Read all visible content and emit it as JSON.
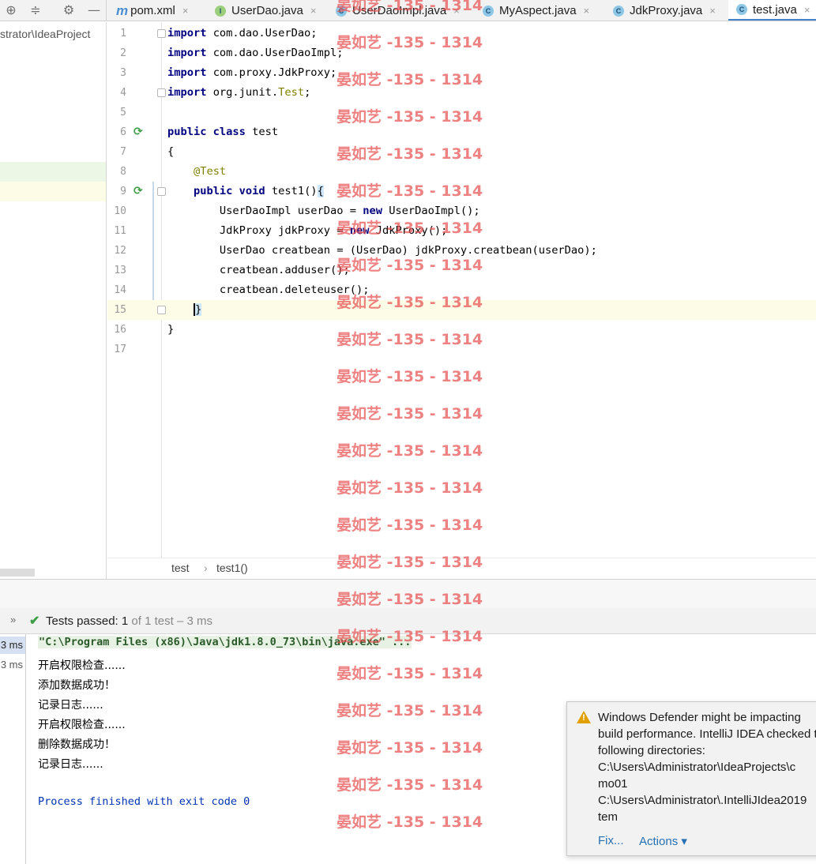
{
  "tabs": [
    {
      "label": "pom.xml",
      "icon": "maven-icon",
      "close": "×"
    },
    {
      "label": "UserDao.java",
      "icon": "interface-icon",
      "close": "×"
    },
    {
      "label": "UserDaoImpl.java",
      "icon": "class-icon",
      "close": "×"
    },
    {
      "label": "MyAspect.java",
      "icon": "class-icon",
      "close": "×"
    },
    {
      "label": "JdkProxy.java",
      "icon": "class-icon",
      "close": "×"
    },
    {
      "label": "test.java",
      "icon": "test-class-icon",
      "close": "×"
    }
  ],
  "project": {
    "path": "strator\\IdeaProject"
  },
  "editor": {
    "lines": [
      {
        "n": "1",
        "code": "import com.dao.UserDao;"
      },
      {
        "n": "2",
        "code": "import com.dao.UserDaoImpl;"
      },
      {
        "n": "3",
        "code": "import com.proxy.JdkProxy;"
      },
      {
        "n": "4",
        "code": "import org.junit.Test;"
      },
      {
        "n": "5",
        "code": ""
      },
      {
        "n": "6",
        "code": "public class test"
      },
      {
        "n": "7",
        "code": "{"
      },
      {
        "n": "8",
        "code": "    @Test"
      },
      {
        "n": "9",
        "code": "    public void test1(){"
      },
      {
        "n": "10",
        "code": "        UserDaoImpl userDao = new UserDaoImpl();"
      },
      {
        "n": "11",
        "code": "        JdkProxy jdkProxy = new JdkProxy();"
      },
      {
        "n": "12",
        "code": "        UserDao creatbean = (UserDao) jdkProxy.creatbean(userDao);"
      },
      {
        "n": "13",
        "code": "        creatbean.adduser();"
      },
      {
        "n": "14",
        "code": "        creatbean.deleteuser();"
      },
      {
        "n": "15",
        "code": "    }"
      },
      {
        "n": "16",
        "code": "}"
      },
      {
        "n": "17",
        "code": ""
      }
    ],
    "current_line": "15"
  },
  "breadcrumb": {
    "class": "test",
    "separator": "›",
    "method": "test1()"
  },
  "run": {
    "expand": "»",
    "status_label": "Tests passed:",
    "status_count": "1",
    "status_rest": "of 1 test – 3 ms",
    "tree_times": [
      "3 ms",
      "3 ms"
    ],
    "console": {
      "command": "\"C:\\Program Files (x86)\\Java\\jdk1.8.0_73\\bin\\java.exe\" ...",
      "output": [
        "开启权限检查......",
        "添加数据成功！",
        "记录日志......",
        "开启权限检查......",
        "删除数据成功！",
        "记录日志......"
      ],
      "exit": "Process finished with exit code 0"
    }
  },
  "notification": {
    "lines": [
      "Windows Defender might be impacting",
      "build performance. IntelliJ IDEA checked the",
      "following directories:",
      "C:\\Users\\Administrator\\IdeaProjects\\c",
      "mo01",
      "C:\\Users\\Administrator\\.IntelliJIdea2019",
      "tem"
    ],
    "fix": "Fix...",
    "actions": "Actions ▾"
  },
  "watermark": "晏如艺 -135 - 1314",
  "colors": {
    "accent": "#4083c9",
    "keyword": "#000080",
    "annotation": "#808000",
    "success": "#3f9d46",
    "warning": "#e0a100",
    "watermark": "#e85050"
  }
}
